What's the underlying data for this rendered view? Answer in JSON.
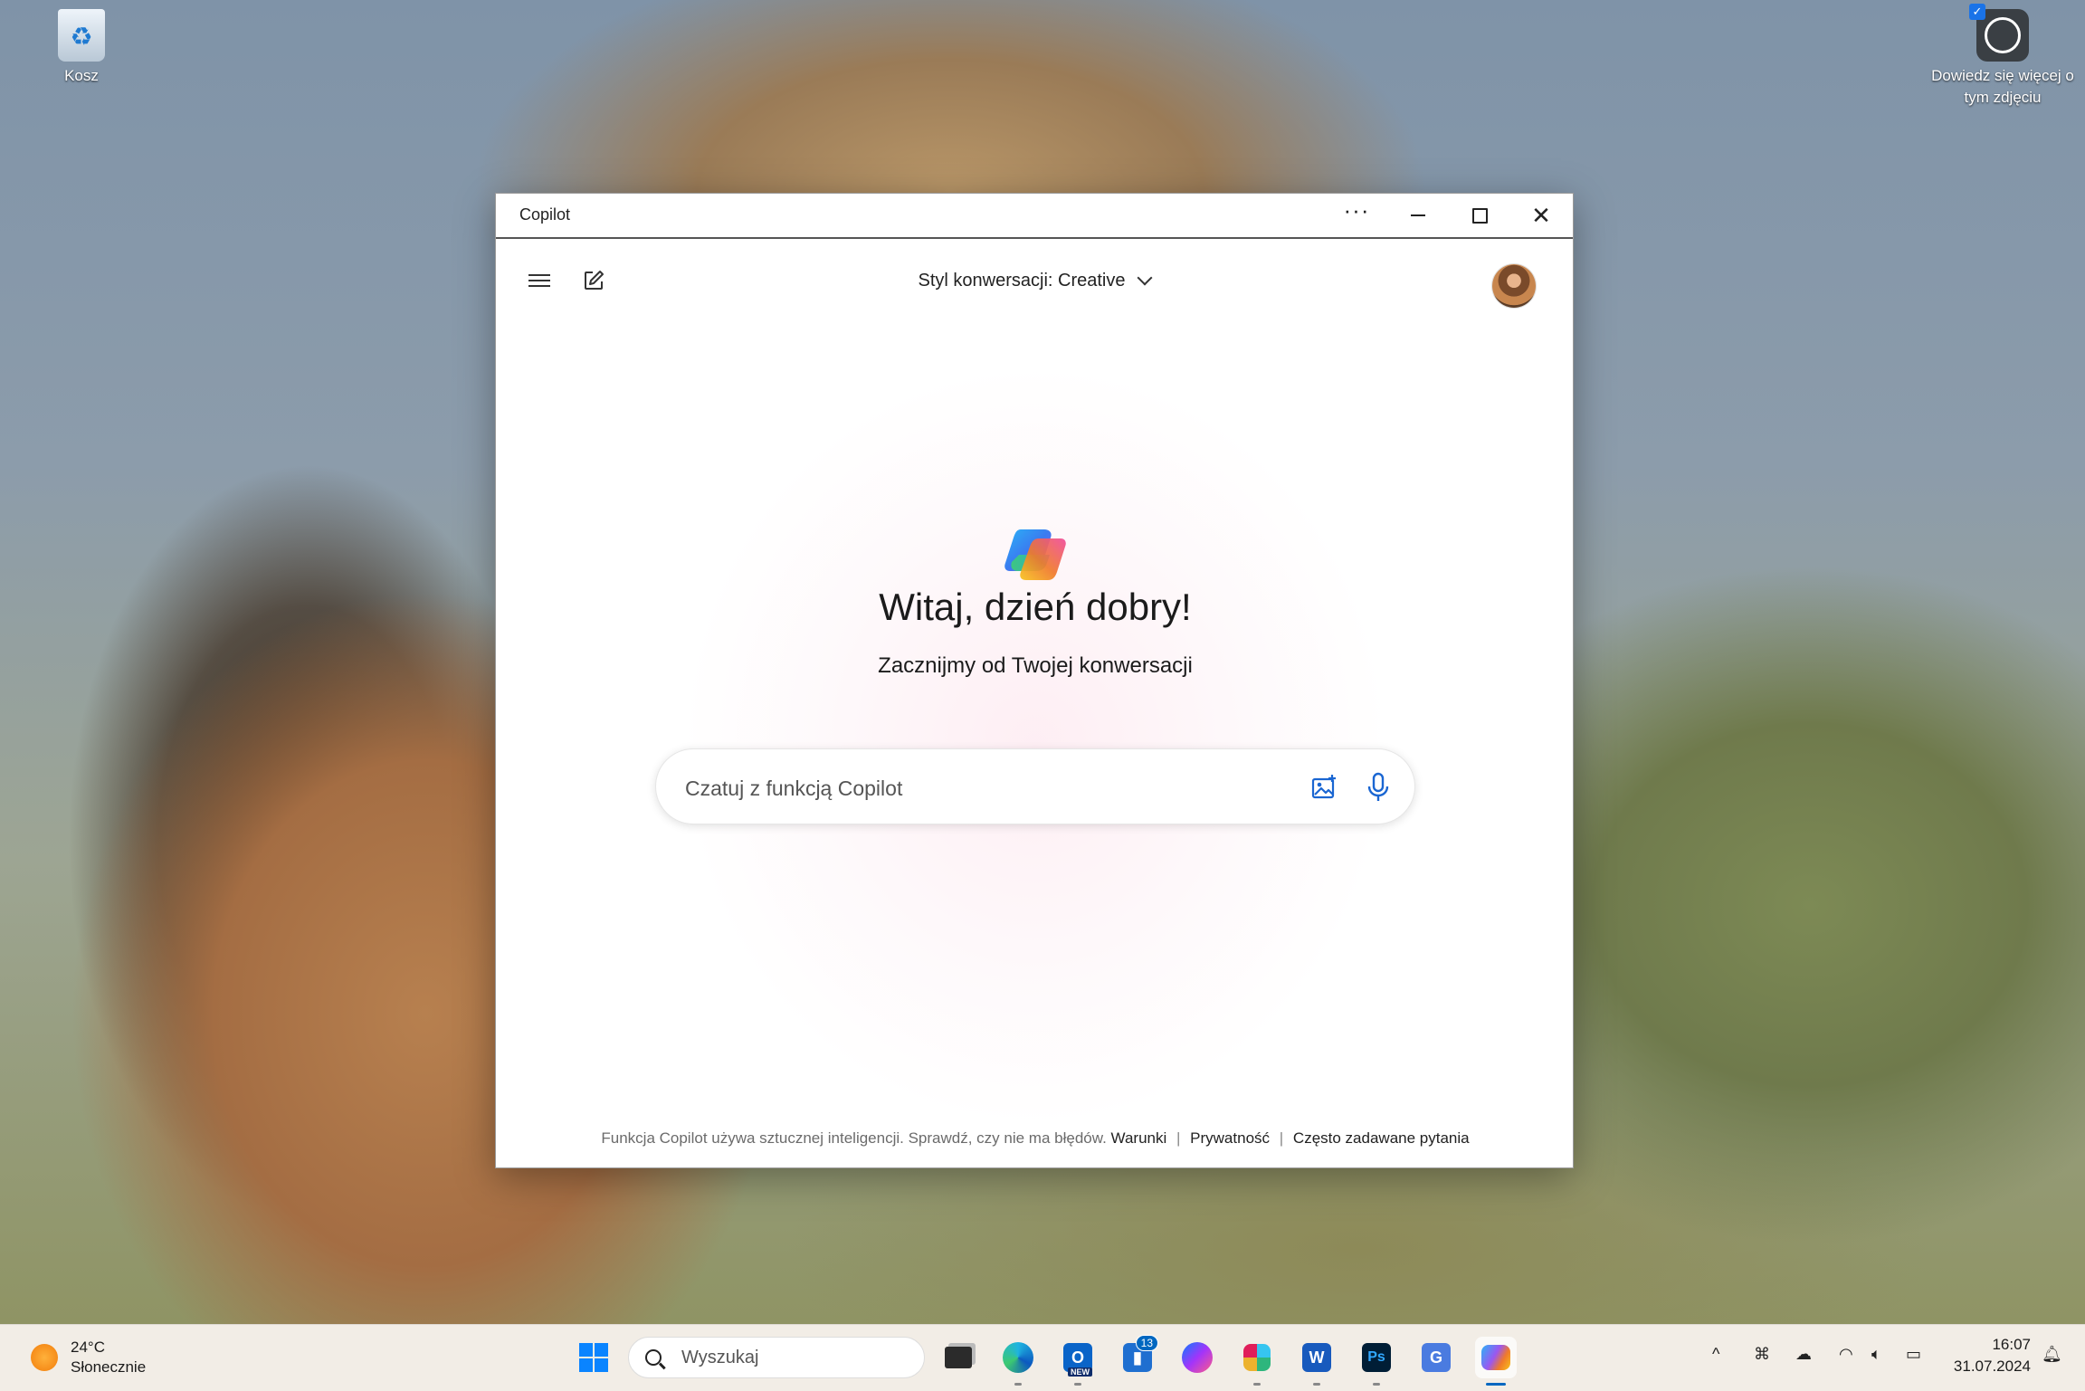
{
  "desktop": {
    "recycle_bin_label": "Kosz",
    "learn_more_label": "Dowiedz się więcej o tym zdjęciu"
  },
  "window": {
    "title": "Copilot",
    "more_glyph": "···",
    "close_glyph": "✕"
  },
  "copilot": {
    "style_label": "Styl konwersacji: Creative",
    "greeting": "Witaj, dzień dobry!",
    "subtitle": "Zacznijmy od Twojej konwersacji",
    "chat_placeholder": "Czatuj z funkcją Copilot",
    "chat_value": "",
    "footer": {
      "disclaimer": "Funkcja Copilot używa sztucznej inteligencji. Sprawdź, czy nie ma błędów.",
      "terms": "Warunki",
      "privacy": "Prywatność",
      "faq": "Często zadawane pytania",
      "separator": "|"
    }
  },
  "taskbar": {
    "weather_temp": "24°C",
    "weather_desc": "Słonecznie",
    "search_label": "Wyszukaj",
    "outlook_badge": "NEW",
    "teams_badge": "13",
    "word_letter": "W",
    "photoshop_letter": "Ps",
    "tray_chevron": "^",
    "time": "16:07",
    "date": "31.07.2024"
  },
  "colors": {
    "accent": "#0067c0",
    "start_blue": "#0a84ff"
  }
}
